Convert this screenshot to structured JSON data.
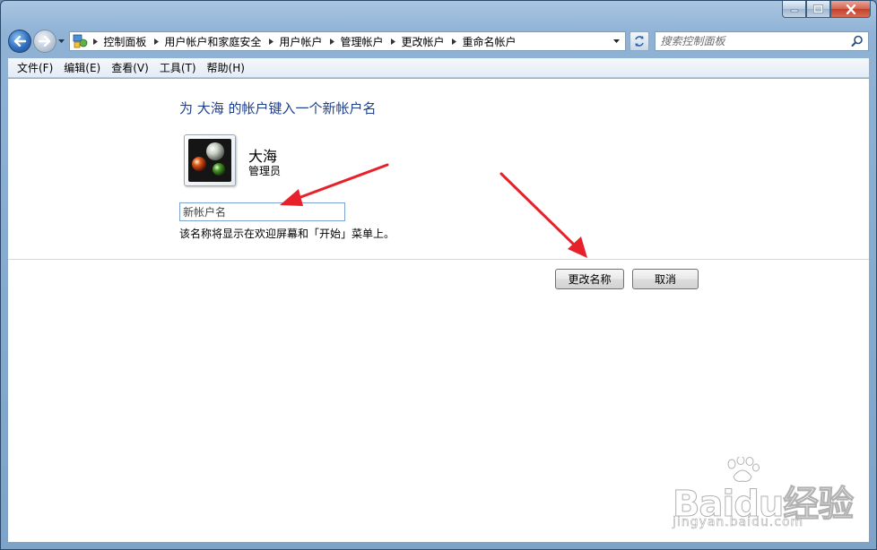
{
  "window": {
    "caption_buttons": [
      "minimize-icon",
      "maximize-icon",
      "close-icon"
    ]
  },
  "address_bar": {
    "breadcrumbs": [
      "控制面板",
      "用户帐户和家庭安全",
      "用户帐户",
      "管理帐户",
      "更改帐户",
      "重命名帐户"
    ]
  },
  "search": {
    "placeholder": "搜索控制面板"
  },
  "menu": {
    "items": [
      "文件(F)",
      "编辑(E)",
      "查看(V)",
      "工具(T)",
      "帮助(H)"
    ]
  },
  "main": {
    "title": "为 大海 的帐户键入一个新帐户名",
    "user": {
      "name": "大海",
      "role": "管理员"
    },
    "new_name_placeholder": "新帐户名",
    "hint": "该名称将显示在欢迎屏幕和「开始」菜单上。",
    "rename_button": "更改名称",
    "cancel_button": "取消"
  },
  "watermark": {
    "brand": "Baidu经验",
    "url": "jingyan.baidu.com"
  },
  "colors": {
    "title_blue": "#1e3f8f",
    "annotation_red": "#e8202a"
  }
}
